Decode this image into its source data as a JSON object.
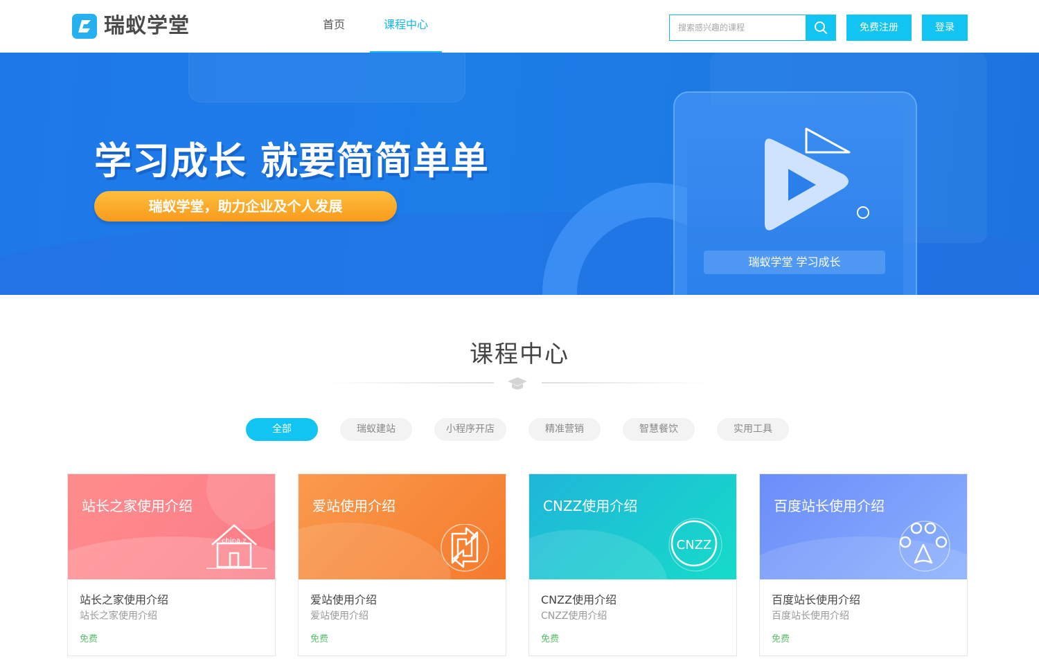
{
  "header": {
    "logo_text": "瑞蚁学堂",
    "nav": [
      {
        "label": "首页",
        "active": false
      },
      {
        "label": "课程中心",
        "active": true
      }
    ],
    "search_placeholder": "搜索感兴趣的课程",
    "register_label": "免费注册",
    "login_label": "登录"
  },
  "banner": {
    "title": "学习成长 就要简简单单",
    "subtitle": "瑞蚁学堂，助力企业及个人发展",
    "device_label": "瑞蚁学堂 学习成长"
  },
  "section": {
    "title": "课程中心",
    "tabs": [
      {
        "label": "全部",
        "active": true
      },
      {
        "label": "瑞蚁建站",
        "active": false
      },
      {
        "label": "小程序开店",
        "active": false
      },
      {
        "label": "精准营销",
        "active": false
      },
      {
        "label": "智慧餐饮",
        "active": false
      },
      {
        "label": "实用工具",
        "active": false
      }
    ]
  },
  "courses": [
    {
      "thumb_title": "站长之家使用介绍",
      "thumb_logo_text": "china.z",
      "name": "站长之家使用介绍",
      "desc": "站长之家使用介绍",
      "price": "免费"
    },
    {
      "thumb_title": "爱站使用介绍",
      "name": "爱站使用介绍",
      "desc": "爱站使用介绍",
      "price": "免费"
    },
    {
      "thumb_title": "CNZZ使用介绍",
      "thumb_logo_text": "CNZZ",
      "name": "CNZZ使用介绍",
      "desc": "CNZZ使用介绍",
      "price": "免费"
    },
    {
      "thumb_title": "百度站长使用介绍",
      "name": "百度站长使用介绍",
      "desc": "百度站长使用介绍",
      "price": "免费"
    }
  ],
  "colors": {
    "accent": "#12c4f1",
    "banner_blue": "#1f78e8",
    "pill_orange": "#f89a1c",
    "price_green": "#5bbf6a"
  }
}
